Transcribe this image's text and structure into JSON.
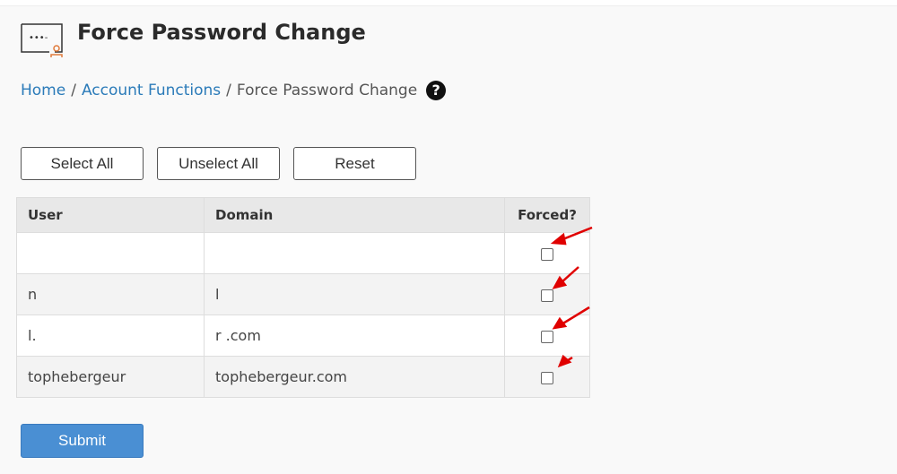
{
  "page": {
    "title": "Force Password Change",
    "icon": "password-field-icon"
  },
  "breadcrumb": {
    "home": "Home",
    "section": "Account Functions",
    "current": "Force Password Change",
    "help_icon": "question-circle-icon"
  },
  "toolbar": {
    "select_all": "Select All",
    "unselect_all": "Unselect All",
    "reset": "Reset"
  },
  "table": {
    "headers": [
      "User",
      "Domain",
      "Forced?"
    ],
    "rows": [
      {
        "user": "",
        "domain": "",
        "forced": false
      },
      {
        "user": "n",
        "domain": "l",
        "forced": false
      },
      {
        "user": "l.",
        "domain": "r .com",
        "forced": false
      },
      {
        "user": "tophebergeur",
        "domain": "tophebergeur.com",
        "forced": false
      }
    ]
  },
  "submit": "Submit",
  "colors": {
    "link": "#2b7bb9",
    "submit": "#4a8fd3",
    "annotation_arrow": "#e00000"
  }
}
